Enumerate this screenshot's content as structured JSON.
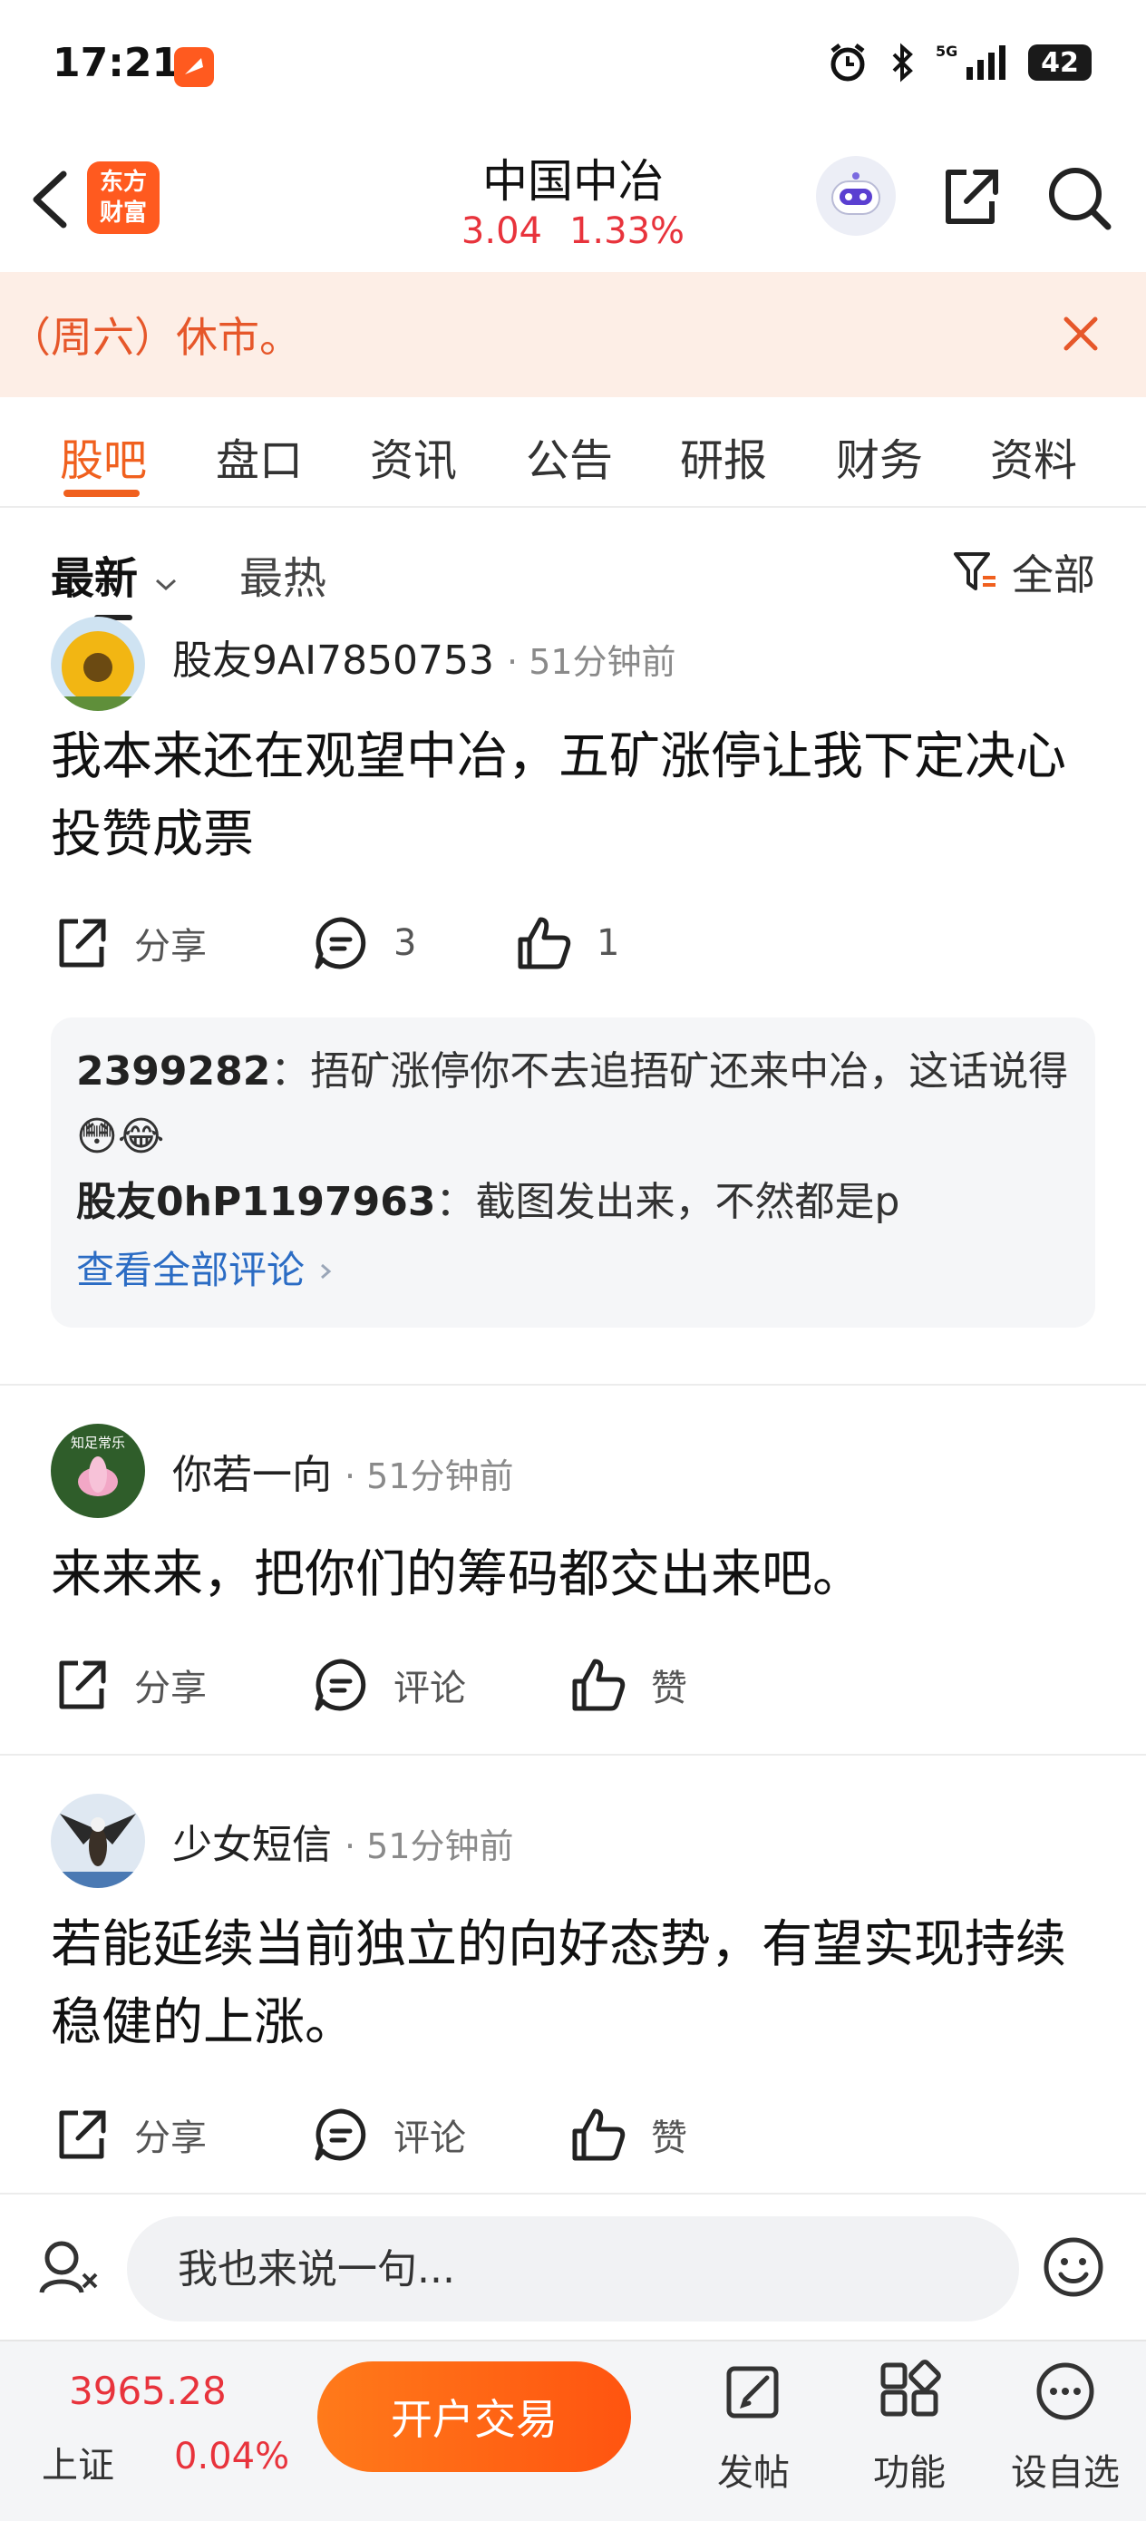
{
  "status_bar": {
    "time": "17:21",
    "battery": "42"
  },
  "header": {
    "logo": "东方\n财富",
    "stock_name": "中国中冶",
    "price": "3.04",
    "change_pct": "1.33%"
  },
  "notice": {
    "text": "（周六）休市。"
  },
  "tabs": [
    "股吧",
    "盘口",
    "资讯",
    "公告",
    "研报",
    "财务",
    "资料"
  ],
  "sort": {
    "latest": "最新",
    "hot": "最热",
    "filter": "全部"
  },
  "posts": [
    {
      "author": "股友9AI7850753",
      "time": "· 51分钟前",
      "body": "我本来还在观望中冶，五矿涨停让我下定决心投赞成票",
      "share": "分享",
      "comments": "3",
      "likes": "1",
      "replies": [
        {
          "user": "2399282",
          "text": "：捂矿涨停你不去追捂矿还来中冶，这话说得😳😂"
        },
        {
          "user": "股友0hP1197963",
          "text": "：截图发出来，不然都是p"
        }
      ],
      "view_all": "查看全部评论"
    },
    {
      "author": "你若一向",
      "time": "· 51分钟前",
      "body": "来来来，把你们的筹码都交出来吧。",
      "share": "分享",
      "comments": "评论",
      "likes": "赞",
      "avatar_text": "知足常乐"
    },
    {
      "author": "少女短信",
      "time": "· 51分钟前",
      "body": "若能延续当前独立的向好态势，有望实现持续稳健的上涨。",
      "share": "分享",
      "comments": "评论",
      "likes": "赞"
    }
  ],
  "composer": {
    "placeholder": "我也来说一句..."
  },
  "bottom_bar": {
    "index_value": "3965.28",
    "index_name": "上证",
    "index_change": "0.04%",
    "trade_button": "开户交易",
    "nav": [
      "发帖",
      "功能",
      "设自选"
    ]
  },
  "colors": {
    "accent": "#f0601e",
    "up": "#e8333c",
    "link": "#2b6cc4"
  }
}
